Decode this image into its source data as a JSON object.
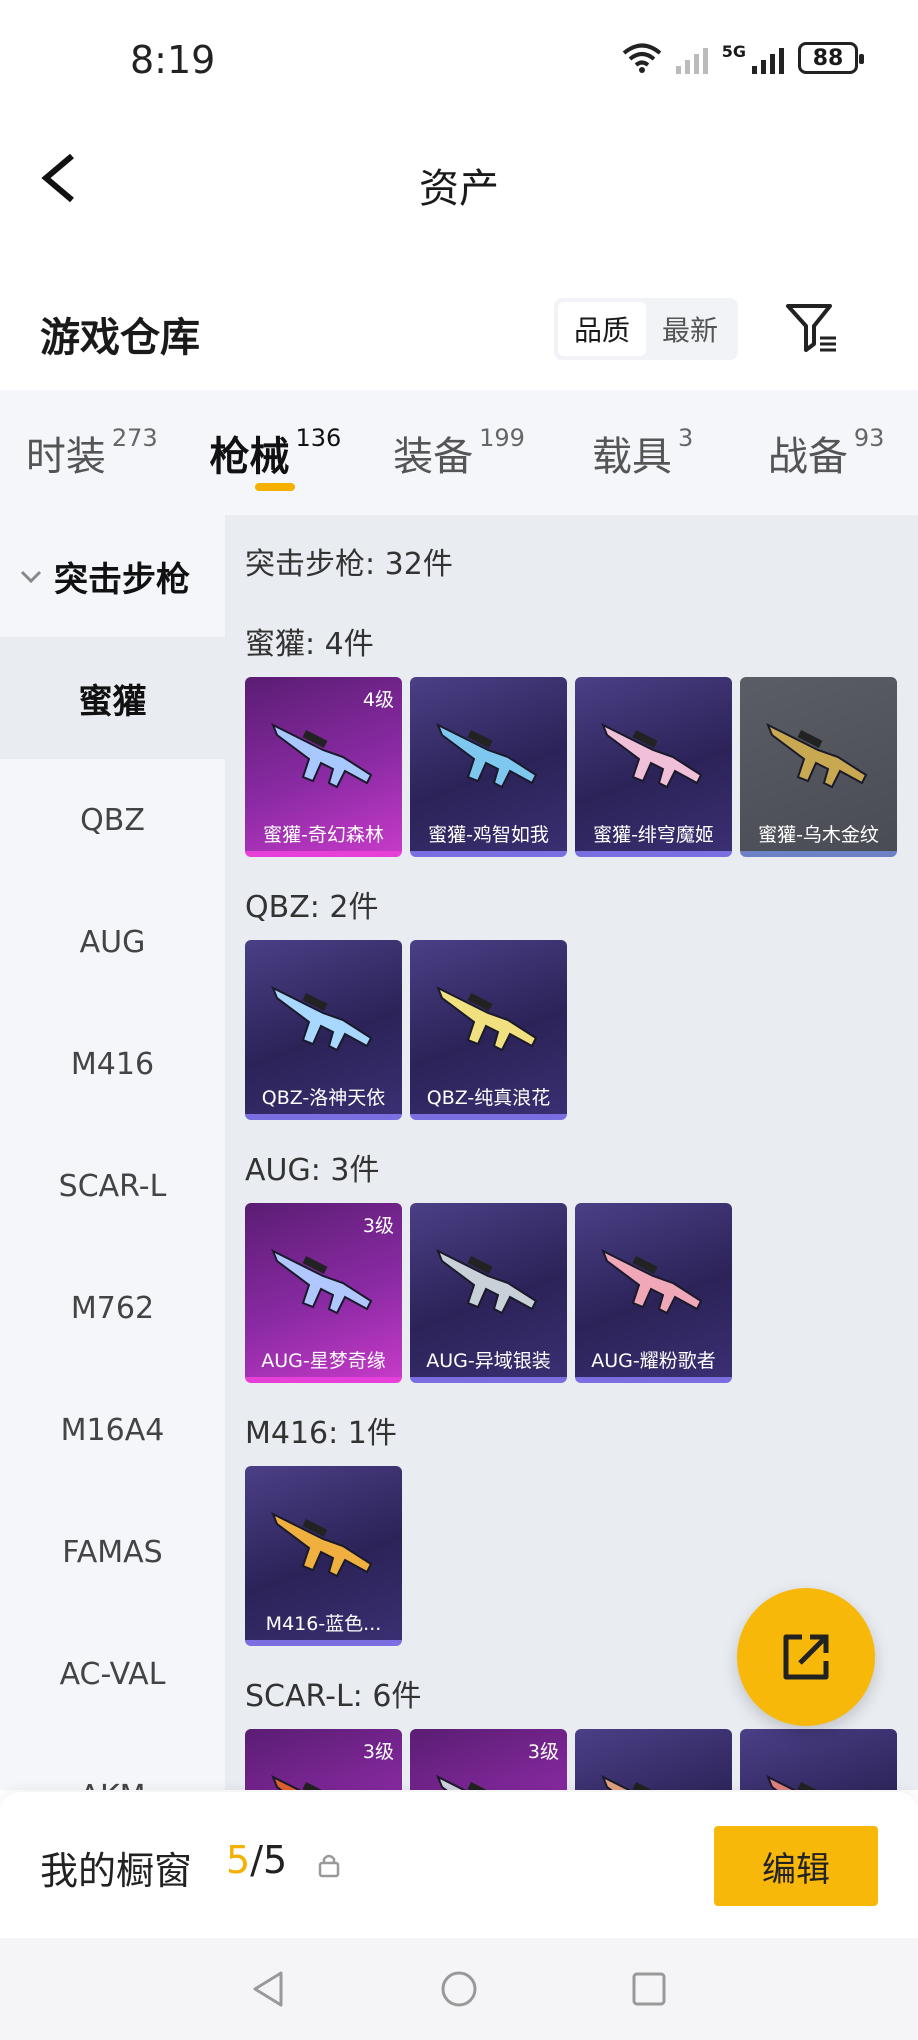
{
  "status": {
    "time": "8:19",
    "network": "5G",
    "battery": "88"
  },
  "header": {
    "title": "资产"
  },
  "warehouse": {
    "title": "游戏仓库",
    "sort_options": [
      "品质",
      "最新"
    ],
    "active_sort": "品质"
  },
  "tabs": [
    {
      "label": "时装",
      "count": "273"
    },
    {
      "label": "枪械",
      "count": "136",
      "active": true
    },
    {
      "label": "装备",
      "count": "199"
    },
    {
      "label": "载具",
      "count": "3"
    },
    {
      "label": "战备",
      "count": "93"
    }
  ],
  "sidebar": {
    "category": "突击步枪",
    "items": [
      "蜜獾",
      "QBZ",
      "AUG",
      "M416",
      "SCAR-L",
      "M762",
      "M16A4",
      "FAMAS",
      "AC-VAL",
      "AKM"
    ],
    "active": "蜜獾"
  },
  "content": {
    "total": "突击步枪: 32件",
    "groups": [
      {
        "title": "蜜獾: 4件",
        "items": [
          {
            "name": "蜜獾-奇幻森林",
            "badge": "4级",
            "rarity": "pink",
            "gun_color": "#a8c8ff"
          },
          {
            "name": "蜜獾-鸡智如我",
            "badge": "",
            "rarity": "purple",
            "gun_color": "#7ec8f0"
          },
          {
            "name": "蜜獾-绯穹魔姬",
            "badge": "",
            "rarity": "purple",
            "gun_color": "#f0c0d8"
          },
          {
            "name": "蜜獾-乌木金纹",
            "badge": "",
            "rarity": "grey",
            "gun_color": "#c8a850"
          }
        ]
      },
      {
        "title": "QBZ: 2件",
        "items": [
          {
            "name": "QBZ-洛神天依",
            "badge": "",
            "rarity": "purple",
            "gun_color": "#a8d8ff"
          },
          {
            "name": "QBZ-纯真浪花",
            "badge": "",
            "rarity": "purple",
            "gun_color": "#f0e080"
          }
        ]
      },
      {
        "title": "AUG: 3件",
        "items": [
          {
            "name": "AUG-星梦奇缘",
            "badge": "3级",
            "rarity": "pink",
            "gun_color": "#b0c8ff"
          },
          {
            "name": "AUG-异域银装",
            "badge": "",
            "rarity": "purple",
            "gun_color": "#c8d0d8"
          },
          {
            "name": "AUG-耀粉歌者",
            "badge": "",
            "rarity": "purple",
            "gun_color": "#f0a8b8"
          }
        ]
      },
      {
        "title": "M416: 1件",
        "items": [
          {
            "name": "M416-蓝色...",
            "badge": "",
            "rarity": "purple",
            "gun_color": "#f0b040"
          }
        ]
      },
      {
        "title": "SCAR-L: 6件",
        "items": [
          {
            "name": "",
            "badge": "3级",
            "rarity": "pink",
            "gun_color": "#e06030"
          },
          {
            "name": "",
            "badge": "3级",
            "rarity": "pink",
            "gun_color": "#d0d0e0"
          },
          {
            "name": "",
            "badge": "",
            "rarity": "purple",
            "gun_color": "#e0a080"
          },
          {
            "name": "",
            "badge": "",
            "rarity": "purple",
            "gun_color": "#e08080"
          }
        ]
      }
    ]
  },
  "bottom": {
    "label": "我的橱窗",
    "count_current": "5",
    "count_total": "/5",
    "edit": "编辑"
  },
  "colors": {
    "accent": "#f8b80a",
    "rarity_pink": "#e640d8",
    "rarity_purple": "#7b6ee0"
  }
}
